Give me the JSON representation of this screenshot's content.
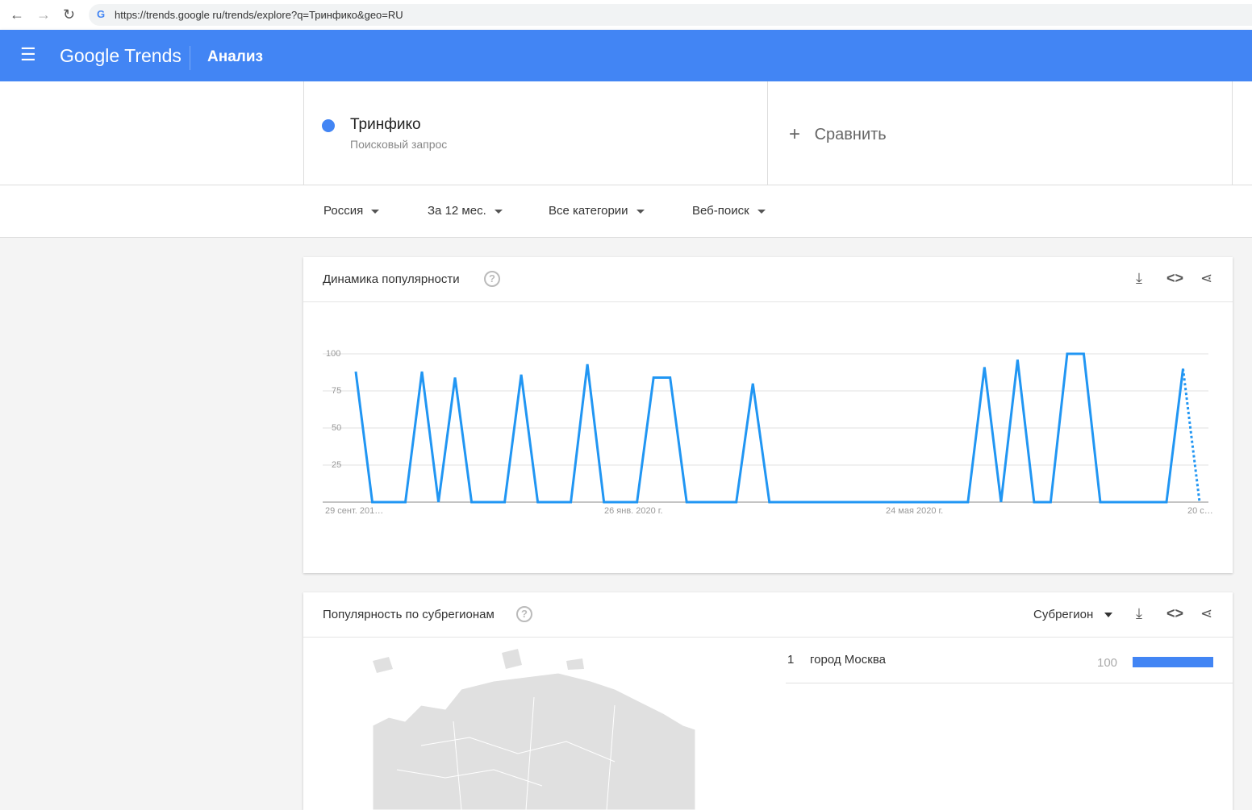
{
  "browser": {
    "url": "https://trends.google ru/trends/explore?q=Тринфико&geo=RU"
  },
  "header": {
    "logo": "Google Trends",
    "section": "Анализ"
  },
  "term": {
    "name": "Тринфико",
    "type": "Поисковый запрос",
    "color": "#4285f4"
  },
  "compare": {
    "label": "Сравнить"
  },
  "filters": {
    "region": "Россия",
    "period": "За 12 мес.",
    "category": "Все категории",
    "search_type": "Веб-поиск"
  },
  "interest_over_time": {
    "title": "Динамика популярности"
  },
  "chart_data": {
    "type": "line",
    "title": "Динамика популярности",
    "ylim": [
      0,
      100
    ],
    "yticks": [
      "100",
      "75",
      "50",
      "25"
    ],
    "xtick_labels": [
      "29 сент. 201…",
      "26 янв. 2020 г.",
      "24 мая 2020 г.",
      "20 с…"
    ],
    "series": [
      {
        "name": "Тринфико",
        "color": "#2196f3",
        "values": [
          88,
          0,
          0,
          0,
          88,
          0,
          84,
          0,
          0,
          0,
          86,
          0,
          0,
          0,
          93,
          0,
          0,
          0,
          84,
          84,
          0,
          0,
          0,
          0,
          80,
          0,
          0,
          0,
          0,
          0,
          0,
          0,
          0,
          0,
          0,
          0,
          0,
          0,
          91,
          0,
          96,
          0,
          0,
          100,
          100,
          0,
          0,
          0,
          0,
          0,
          90,
          0
        ],
        "partial_last_point": true
      }
    ]
  },
  "subregion": {
    "title": "Популярность по субрегионам",
    "dropdown": "Субрегион",
    "rows": [
      {
        "rank": "1",
        "name": "город Москва",
        "value": "100",
        "fraction": 1.0
      }
    ]
  }
}
